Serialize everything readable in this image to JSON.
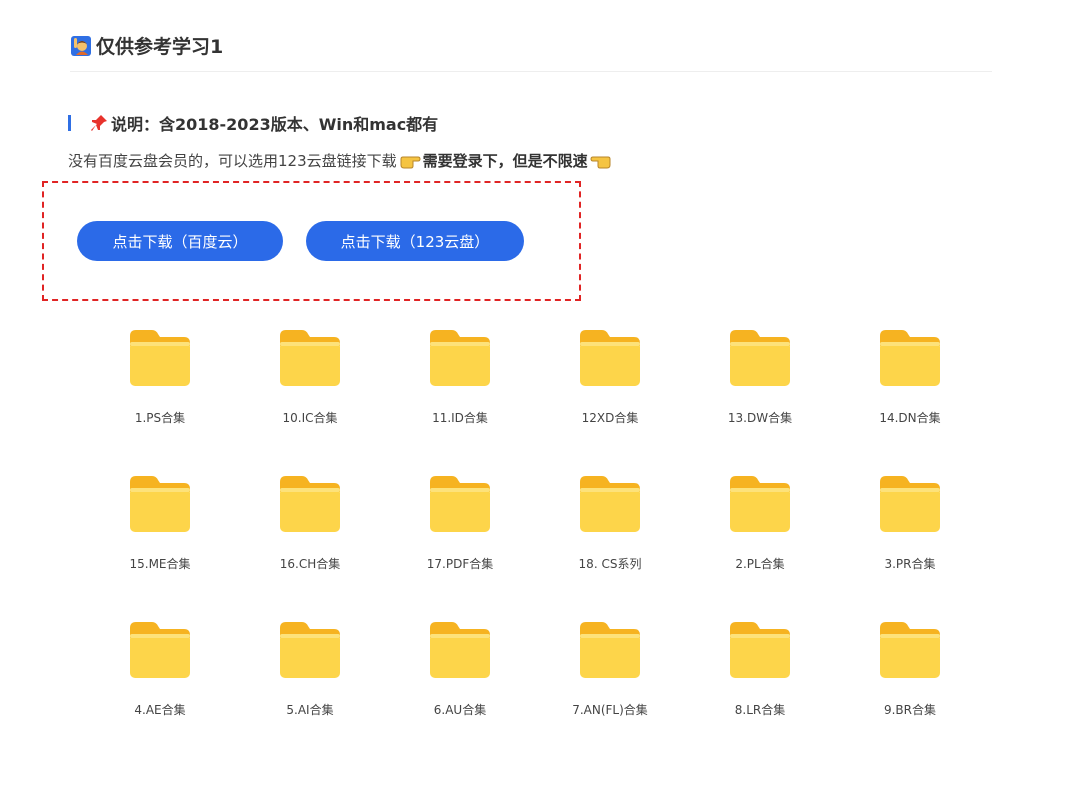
{
  "header": {
    "title": "仅供参考学习1",
    "title_icon": "person-raising-hand-icon"
  },
  "section": {
    "heading": "说明：含2018-2023版本、Win和mac都有",
    "heading_icon": "pushpin-icon",
    "desc_prefix": "没有百度云盘会员的，可以选用123云盘链接下载",
    "desc_bold": "需要登录下，但是不限速",
    "accent": "#2f6fe4"
  },
  "downloads": {
    "baidu_label": "点击下载（百度云）",
    "pan123_label": "点击下载（123云盘）",
    "button_color": "#2b6ae8",
    "highlight_border": "#e02424"
  },
  "folders": [
    {
      "label": "1.PS合集"
    },
    {
      "label": "10.IC合集"
    },
    {
      "label": "11.ID合集"
    },
    {
      "label": "12XD合集"
    },
    {
      "label": "13.DW合集"
    },
    {
      "label": "14.DN合集"
    },
    {
      "label": "15.ME合集"
    },
    {
      "label": "16.CH合集"
    },
    {
      "label": "17.PDF合集"
    },
    {
      "label": "18. CS系列"
    },
    {
      "label": "2.PL合集"
    },
    {
      "label": "3.PR合集"
    },
    {
      "label": "4.AE合集"
    },
    {
      "label": "5.AI合集"
    },
    {
      "label": "6.AU合集"
    },
    {
      "label": "7.AN(FL)合集"
    },
    {
      "label": "8.LR合集"
    },
    {
      "label": "9.BR合集"
    }
  ]
}
